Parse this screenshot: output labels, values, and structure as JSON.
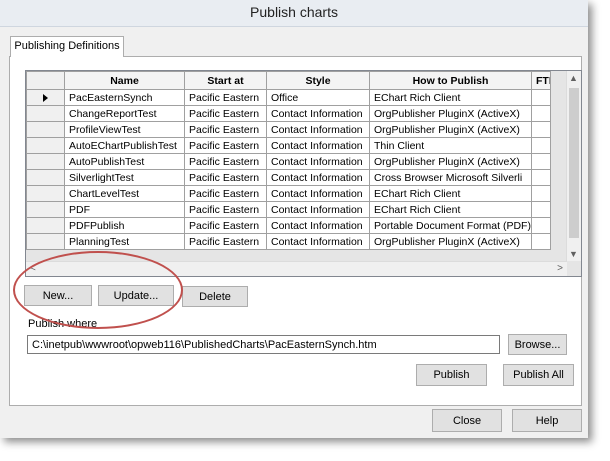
{
  "window": {
    "title": "Publish charts"
  },
  "tabs": [
    {
      "label": "Publishing Definitions"
    }
  ],
  "grid": {
    "columns": [
      "Name",
      "Start at",
      "Style",
      "How to Publish",
      "FTP"
    ],
    "rows": [
      {
        "name": "PacEasternSynch",
        "start": "Pacific Eastern",
        "style": "Office",
        "how": "EChart Rich Client"
      },
      {
        "name": "ChangeReportTest",
        "start": "Pacific Eastern",
        "style": "Contact Information",
        "how": "OrgPublisher PluginX  (ActiveX)"
      },
      {
        "name": "ProfileViewTest",
        "start": "Pacific Eastern",
        "style": "Contact Information",
        "how": "OrgPublisher PluginX  (ActiveX)"
      },
      {
        "name": "AutoEChartPublishTest",
        "start": "Pacific Eastern",
        "style": "Contact Information",
        "how": "Thin Client"
      },
      {
        "name": "AutoPublishTest",
        "start": "Pacific Eastern",
        "style": "Contact Information",
        "how": "OrgPublisher PluginX  (ActiveX)"
      },
      {
        "name": "SilverlightTest",
        "start": "Pacific Eastern",
        "style": "Contact Information",
        "how": "Cross Browser Microsoft Silverli"
      },
      {
        "name": "ChartLevelTest",
        "start": "Pacific Eastern",
        "style": "Contact Information",
        "how": "EChart Rich Client"
      },
      {
        "name": "PDF",
        "start": "Pacific Eastern",
        "style": "Contact Information",
        "how": "EChart Rich Client"
      },
      {
        "name": "PDFPublish",
        "start": "Pacific Eastern",
        "style": "Contact Information",
        "how": "Portable Document Format (PDF)"
      },
      {
        "name": "PlanningTest",
        "start": "Pacific Eastern",
        "style": "Contact Information",
        "how": "OrgPublisher PluginX  (ActiveX)"
      }
    ]
  },
  "buttons": {
    "new": "New...",
    "update": "Update...",
    "delete": "Delete",
    "browse": "Browse...",
    "publish": "Publish",
    "publish_all": "Publish All",
    "close": "Close",
    "help": "Help"
  },
  "publish_where": {
    "label": "Publish where",
    "value": "C:\\inetpub\\wwwroot\\opweb116\\PublishedCharts\\PacEasternSynch.htm"
  },
  "colors": {
    "highlight_ellipse": "#c0504d"
  },
  "icons": {
    "scroll_up": "chevron-up-icon",
    "scroll_down": "chevron-down-icon",
    "scroll_left": "chevron-left-icon",
    "scroll_right": "chevron-right-icon",
    "current_row": "row-pointer-icon"
  }
}
